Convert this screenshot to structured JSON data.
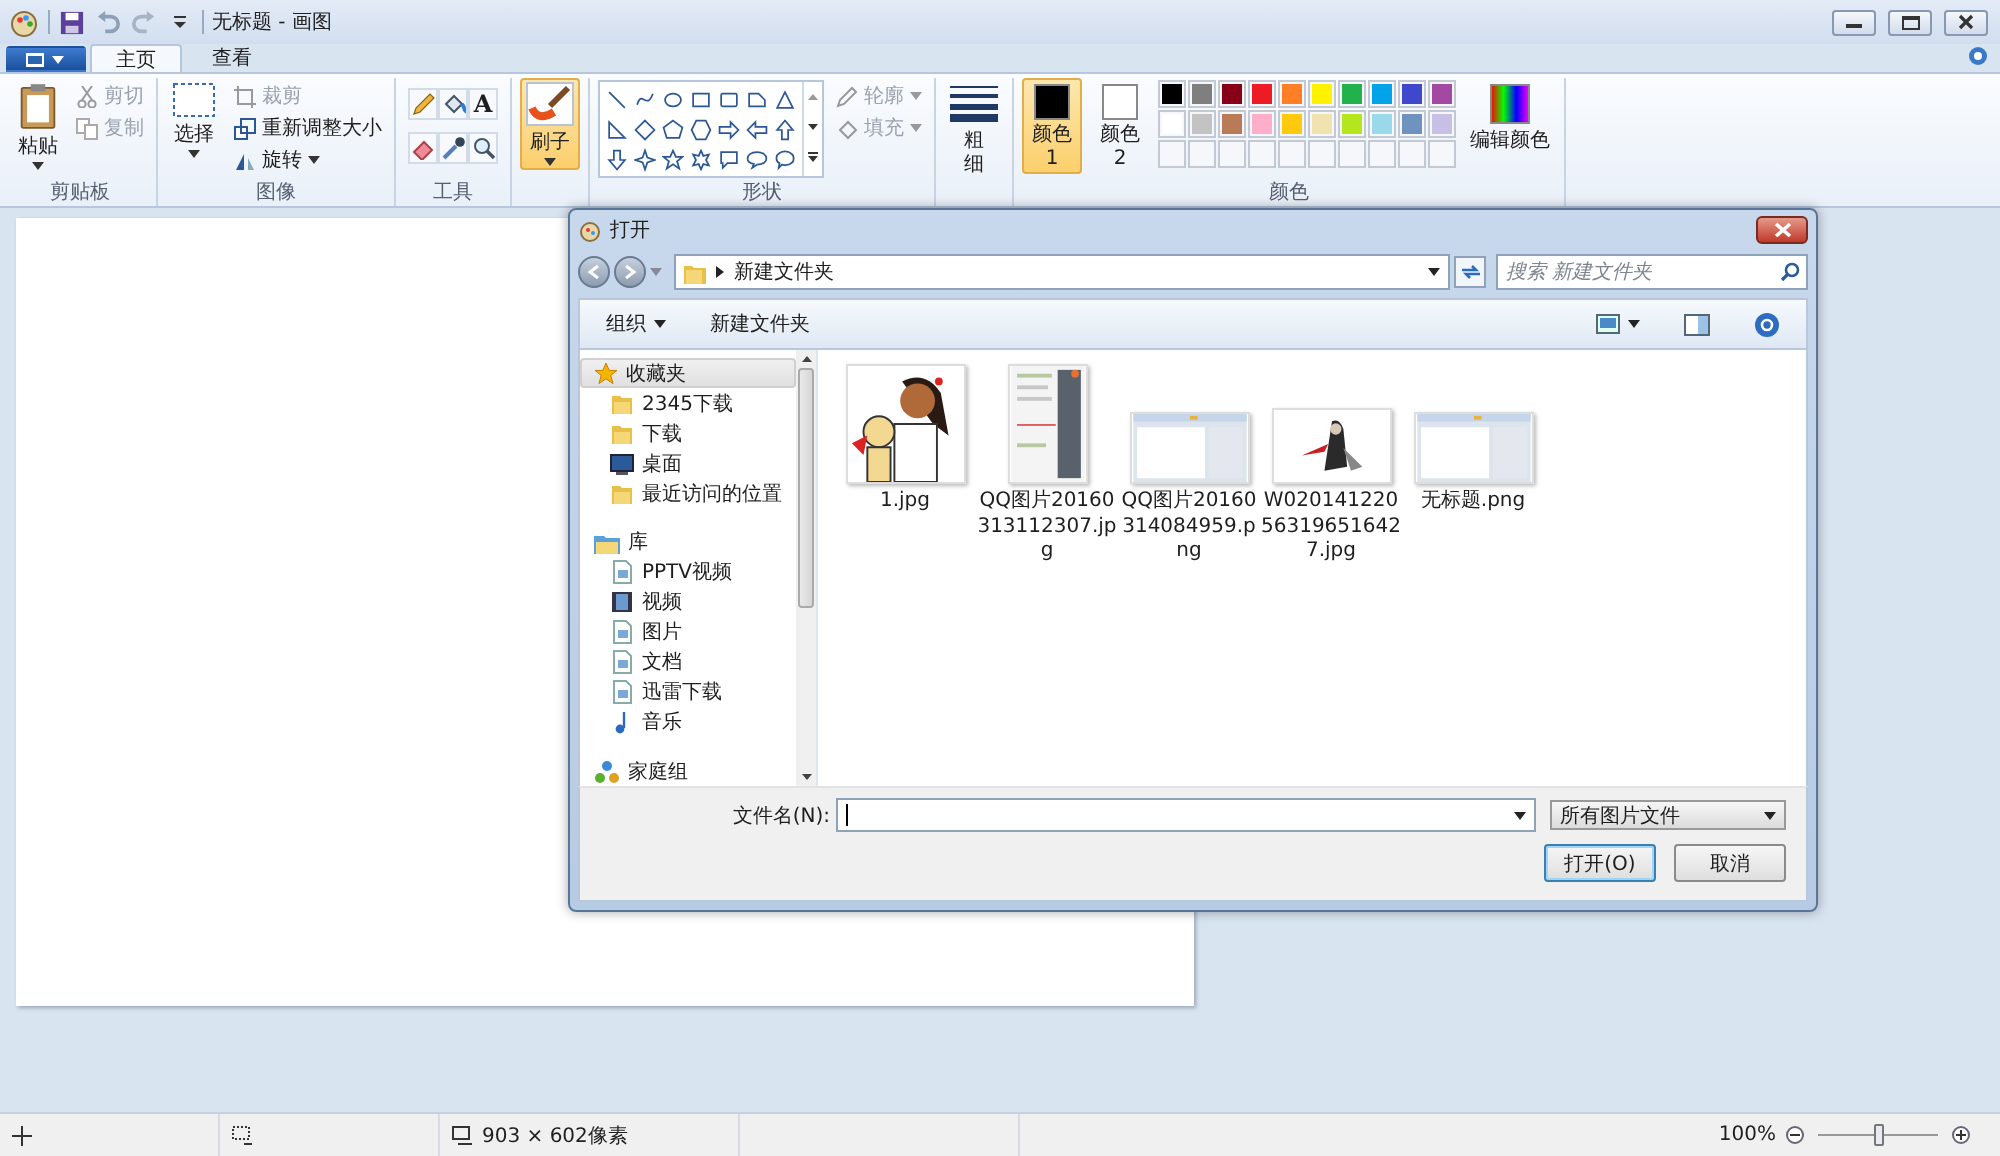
{
  "window": {
    "title": "无标题 - 画图"
  },
  "ribbon_tabs": [
    {
      "label": "主页",
      "selected": true
    },
    {
      "label": "查看",
      "selected": false
    }
  ],
  "ribbon": {
    "clipboard": {
      "label": "剪贴板",
      "paste": "粘贴",
      "items": [
        {
          "label": "剪切",
          "disabled": true
        },
        {
          "label": "复制",
          "disabled": true
        }
      ]
    },
    "image": {
      "label": "图像",
      "select": "选择",
      "items": [
        {
          "label": "裁剪",
          "disabled": true
        },
        {
          "label": "重新调整大小",
          "disabled": false
        },
        {
          "label": "旋转",
          "disabled": false
        }
      ]
    },
    "tools": {
      "label": "工具",
      "text_tool": "A"
    },
    "brushes": {
      "label": "刷子",
      "selected": true
    },
    "shapes": {
      "label": "形状",
      "items": [
        {
          "label": "轮廓",
          "disabled": true
        },
        {
          "label": "填充",
          "disabled": true
        }
      ]
    },
    "size": {
      "label": "粗细"
    },
    "colors": {
      "label": "颜色",
      "slots": [
        {
          "label": "颜色 1",
          "color": "#000000",
          "selected": true
        },
        {
          "label": "颜色 2",
          "color": "#ffffff",
          "selected": false
        }
      ],
      "palette": [
        {
          "color": "#000000"
        },
        {
          "color": "#7f7f7f"
        },
        {
          "color": "#880015"
        },
        {
          "color": "#ed1c24"
        },
        {
          "color": "#ff7f27"
        },
        {
          "color": "#fff200"
        },
        {
          "color": "#22b14c"
        },
        {
          "color": "#00a2e8"
        },
        {
          "color": "#3f48cc"
        },
        {
          "color": "#a349a4"
        },
        {
          "color": "#ffffff"
        },
        {
          "color": "#c3c3c3"
        },
        {
          "color": "#b97a57"
        },
        {
          "color": "#ffaec9"
        },
        {
          "color": "#ffc90e"
        },
        {
          "color": "#efe4b0"
        },
        {
          "color": "#b5e61d"
        },
        {
          "color": "#99d9ea"
        },
        {
          "color": "#7092be"
        },
        {
          "color": "#c8bfe7"
        }
      ],
      "edit": "编辑颜色"
    }
  },
  "dialog": {
    "title": "打开",
    "path": [
      "新建文件夹"
    ],
    "search": {
      "placeholder": "搜索 新建文件夹"
    },
    "toolbar": [
      {
        "label": "组织",
        "has_menu": true
      },
      {
        "label": "新建文件夹",
        "has_menu": false
      }
    ],
    "nav": [
      {
        "label": "收藏夹",
        "selected": true,
        "children": [
          {
            "label": "2345下载",
            "selected": false
          },
          {
            "label": "下载",
            "selected": false
          },
          {
            "label": "桌面",
            "selected": false
          },
          {
            "label": "最近访问的位置",
            "selected": false
          }
        ]
      },
      {
        "label": "库",
        "selected": false,
        "children": [
          {
            "label": "PPTV视频",
            "selected": false
          },
          {
            "label": "视频",
            "selected": false
          },
          {
            "label": "图片",
            "selected": false
          },
          {
            "label": "文档",
            "selected": false
          },
          {
            "label": "迅雷下载",
            "selected": false
          },
          {
            "label": "音乐",
            "selected": false
          }
        ]
      },
      {
        "label": "家庭组",
        "selected": false
      }
    ],
    "files": [
      {
        "name": "1.jpg"
      },
      {
        "name": "QQ图片20160313112307.jpg"
      },
      {
        "name": "QQ图片20160314084959.png"
      },
      {
        "name": "W020141220563196516427.jpg"
      },
      {
        "name": "无标题.png"
      }
    ],
    "filename": {
      "label": "文件名(N):"
    },
    "filter": "所有图片文件",
    "buttons": [
      {
        "label": "打开(O)",
        "default": true
      },
      {
        "label": "取消",
        "default": false
      }
    ]
  },
  "status_bar": {
    "size": "903 × 602像素",
    "zoom": {
      "reading": "100%",
      "level": 0.5
    }
  }
}
